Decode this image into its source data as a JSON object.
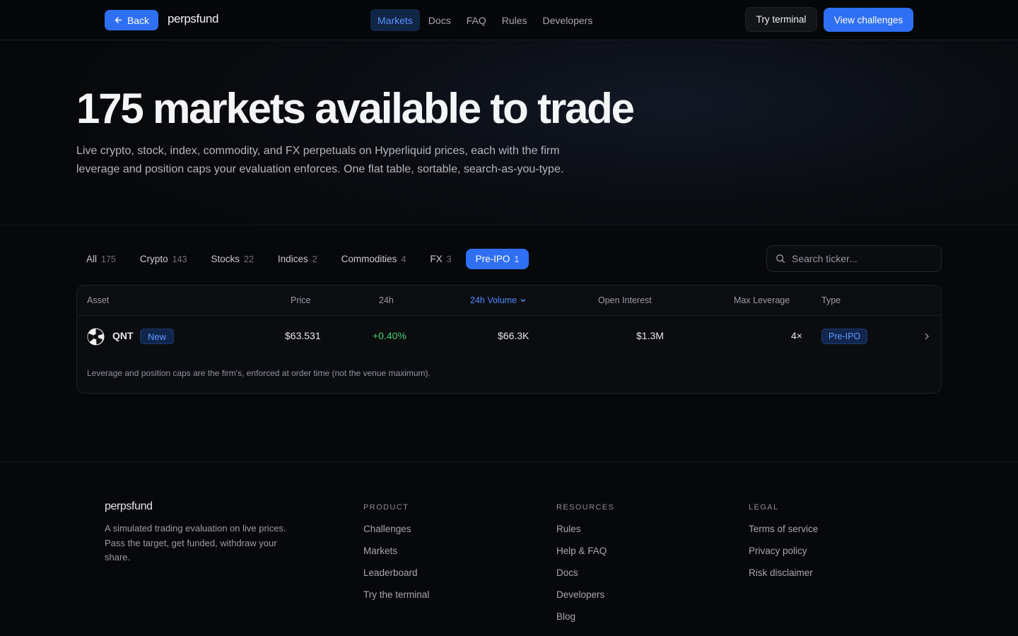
{
  "nav": {
    "back_label": "Back",
    "logo": "perpsfund",
    "links": [
      "Markets",
      "Docs",
      "FAQ",
      "Rules",
      "Developers"
    ],
    "active_link": "Markets",
    "try_terminal": "Try terminal",
    "view_challenges": "View challenges"
  },
  "hero": {
    "title": "175 markets available to trade",
    "subtitle": "Live crypto, stock, index, commodity, and FX perpetuals on Hyperliquid prices, each with the firm leverage and position caps your evaluation enforces. One flat table, sortable, search-as-you-type."
  },
  "filters": {
    "tabs": [
      {
        "label": "All",
        "count": "175"
      },
      {
        "label": "Crypto",
        "count": "143"
      },
      {
        "label": "Stocks",
        "count": "22"
      },
      {
        "label": "Indices",
        "count": "2"
      },
      {
        "label": "Commodities",
        "count": "4"
      },
      {
        "label": "FX",
        "count": "3"
      },
      {
        "label": "Pre-IPO",
        "count": "1"
      }
    ],
    "active": "Pre-IPO"
  },
  "search": {
    "placeholder": "Search ticker..."
  },
  "table": {
    "columns": {
      "asset": "Asset",
      "price": "Price",
      "change": "24h",
      "volume": "24h Volume",
      "oi": "Open Interest",
      "leverage": "Max Leverage",
      "type": "Type"
    },
    "sorted_by": "24h Volume",
    "rows": [
      {
        "ticker": "QNT",
        "badge": "New",
        "price": "$63.531",
        "change": "+0.40%",
        "volume": "$66.3K",
        "open_interest": "$1.3M",
        "max_leverage": "4×",
        "type": "Pre-IPO"
      }
    ],
    "note": "Leverage and position caps are the firm's, enforced at order time (not the venue maximum)."
  },
  "footer": {
    "logo": "perpsfund",
    "tagline": "A simulated trading evaluation on live prices. Pass the target, get funded, withdraw your share.",
    "product": {
      "heading": "PRODUCT",
      "links": [
        "Challenges",
        "Markets",
        "Leaderboard",
        "Try the terminal"
      ]
    },
    "resources": {
      "heading": "RESOURCES",
      "links": [
        "Rules",
        "Help & FAQ",
        "Docs",
        "Developers",
        "Blog"
      ]
    },
    "legal": {
      "heading": "LEGAL",
      "links": [
        "Terms of service",
        "Privacy policy",
        "Risk disclaimer"
      ]
    }
  },
  "colors": {
    "accent": "#2f6ff3",
    "positive": "#3ecf6e",
    "background": "#07080a"
  }
}
